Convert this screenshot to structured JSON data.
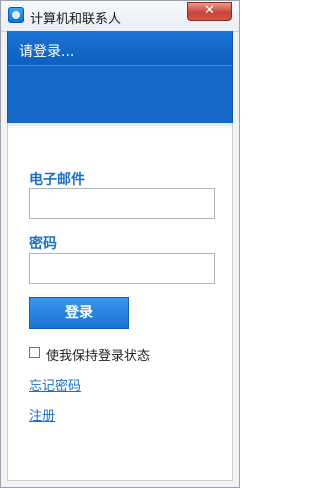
{
  "window": {
    "title": "计算机和联系人",
    "close_label": "✕"
  },
  "header": {
    "status_text": "请登录..."
  },
  "form": {
    "email_label": "电子邮件",
    "email_value": "",
    "password_label": "密码",
    "password_value": "",
    "login_button": "登录",
    "remember_label": "使我保持登录状态",
    "remember_checked": false,
    "forgot_link": "忘记密码",
    "register_link": "注册"
  },
  "colors": {
    "header_blue": "#1568c8",
    "label_blue": "#1a6fc8",
    "button_blue": "#1a74d6"
  },
  "icons": {
    "app": "teamviewer-icon",
    "close": "close-icon"
  }
}
